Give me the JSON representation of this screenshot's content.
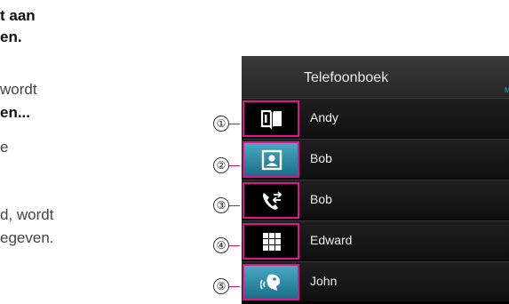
{
  "document": {
    "lines": [
      "t aan",
      "en.",
      "wordt",
      "en...",
      "e",
      "d, wordt",
      "egeven."
    ]
  },
  "callouts": [
    "①",
    "②",
    "③",
    "④",
    "⑤"
  ],
  "screen": {
    "title": "Telefoonboek",
    "title_right_fragment": "M",
    "contacts": [
      "Andy",
      "Bob",
      "Bob",
      "Edward",
      "John"
    ],
    "icons": [
      "phonebook-icon",
      "contact-card-icon",
      "call-history-icon",
      "keypad-icon",
      "voice-recognition-icon"
    ],
    "accent_color": "#e0138c",
    "selected_tile_color": "#2a89a8"
  }
}
